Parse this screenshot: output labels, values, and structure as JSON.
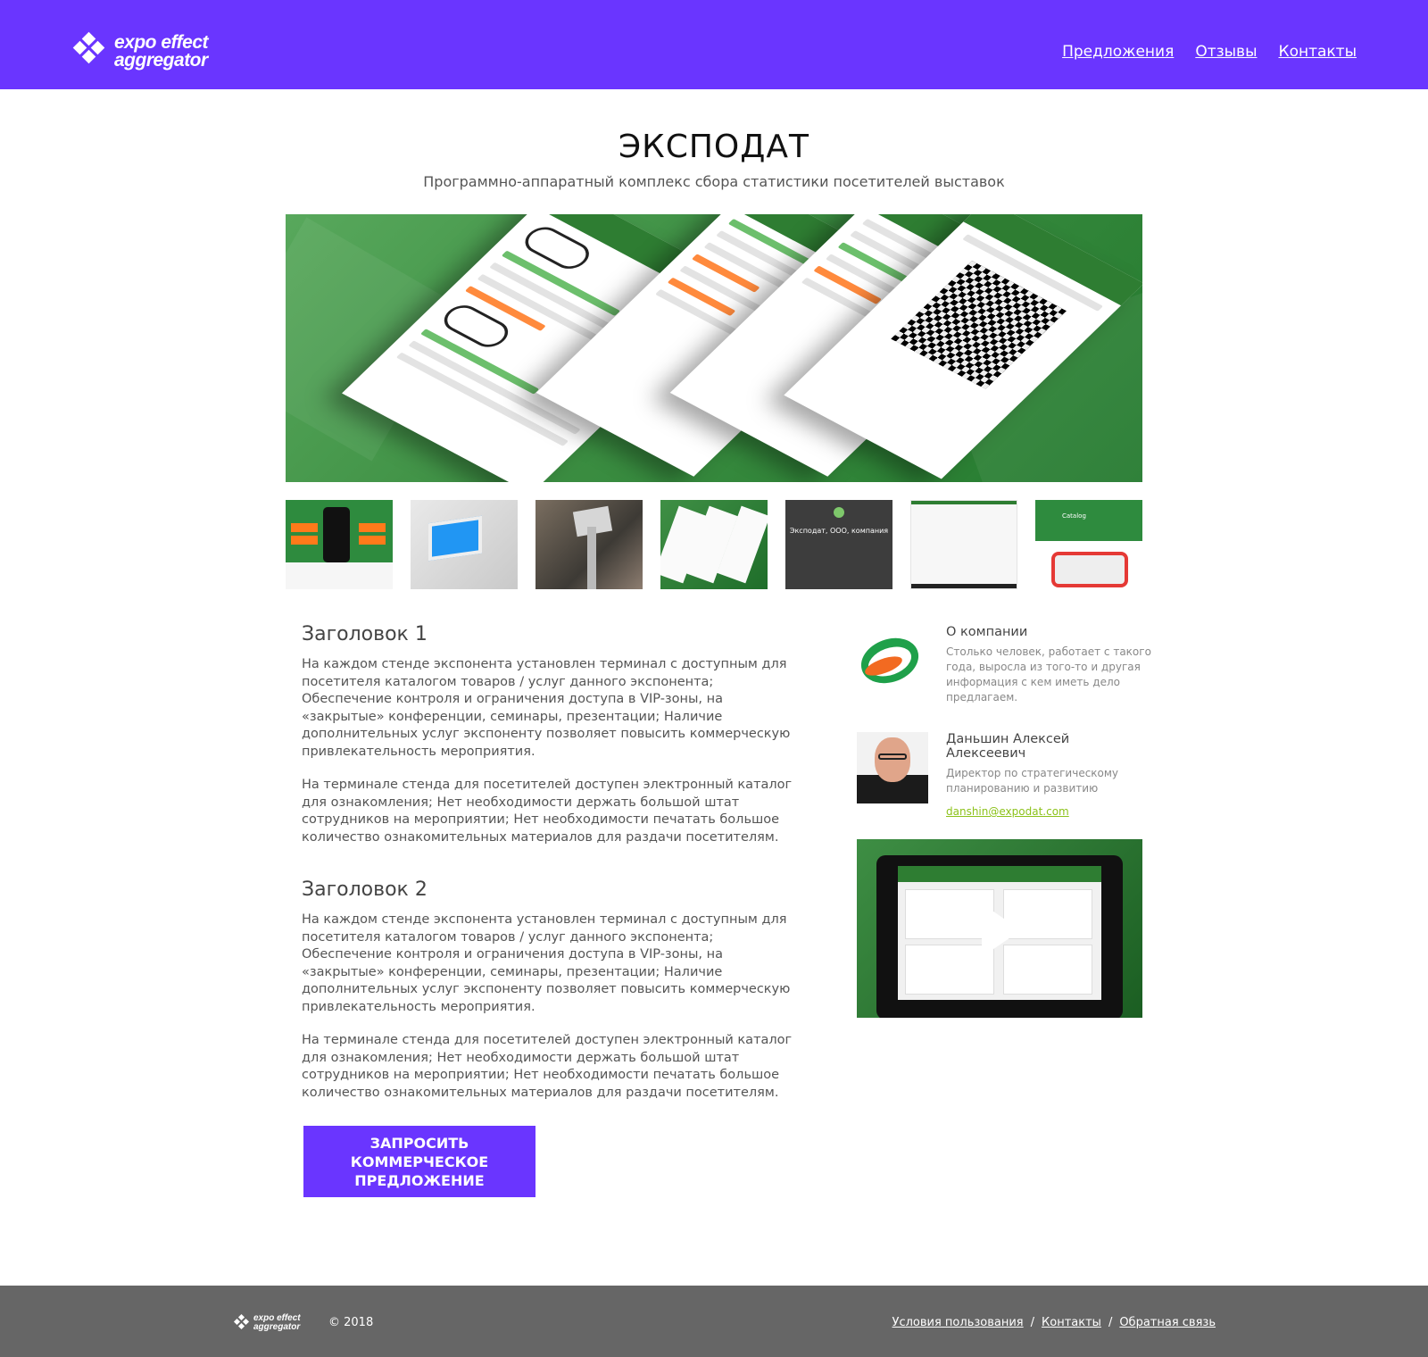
{
  "header": {
    "logo_line1": "expo effect",
    "logo_line2": "aggregator",
    "nav": [
      "Предложения",
      "Отзывы",
      "Контакты"
    ]
  },
  "page": {
    "title": "ЭКСПОДАТ",
    "subtitle": "Программно-аппаратный комплекс сбора статистики посетителей выставок"
  },
  "thumbnails": {
    "t5_caption": "Эксподат, ООО, компания",
    "t7_caption": "Catalog"
  },
  "sections": [
    {
      "heading": "Заголовок 1",
      "p1": "На каждом стенде экспонента установлен терминал с доступным для посетителя каталогом товаров / услуг данного экспонента; Обеспечение контроля и ограничения доступа в VIP-зоны, на «закрытые» конференции, семинары, презентации; Наличие дополнительных услуг экспоненту позволяет повысить коммерческую привлекательность мероприятия.",
      "p2": "На терминале стенда для посетителей доступен электронный каталог для ознакомления; Нет необходимости держать большой штат сотрудников на мероприятии; Нет необходимости печатать большое количество ознакомительных материалов для раздачи посетителям."
    },
    {
      "heading": "Заголовок 2",
      "p1": "На каждом стенде экспонента установлен терминал с доступным для посетителя каталогом товаров / услуг данного экспонента; Обеспечение контроля и ограничения доступа в VIP-зоны, на «закрытые» конференции, семинары, презентации; Наличие дополнительных услуг экспоненту позволяет повысить коммерческую привлекательность мероприятия.",
      "p2": "На терминале стенда для посетителей доступен электронный каталог для ознакомления; Нет необходимости держать большой штат сотрудников на мероприятии; Нет необходимости печатать большое количество ознакомительных материалов для раздачи посетителям."
    }
  ],
  "cta": {
    "label": "ЗАПРОСИТЬ КОММЕРЧЕСКОЕ ПРЕДЛОЖЕНИЕ"
  },
  "company": {
    "title": "О компании",
    "description": "Столько человек, работает с такого года, выросла из того-то и другая информация с кем иметь дело предлагаем."
  },
  "contact": {
    "name": "Даньшин Алексей Алексеевич",
    "role": "Директор по стратегическому планированию и развитию",
    "email": "danshin@expodat.com"
  },
  "footer": {
    "logo_line1": "expo effect",
    "logo_line2": "aggregator",
    "copyright": "© 2018",
    "links": [
      "Условия пользования",
      "Контакты",
      "Обратная связь"
    ],
    "separator": "/"
  },
  "colors": {
    "brand": "#6a35ff",
    "footer": "#666666",
    "link_green": "#8cc21a",
    "hero_green": "#3c8e42"
  },
  "icons": [
    "logo-diamond-icon",
    "play-icon"
  ]
}
